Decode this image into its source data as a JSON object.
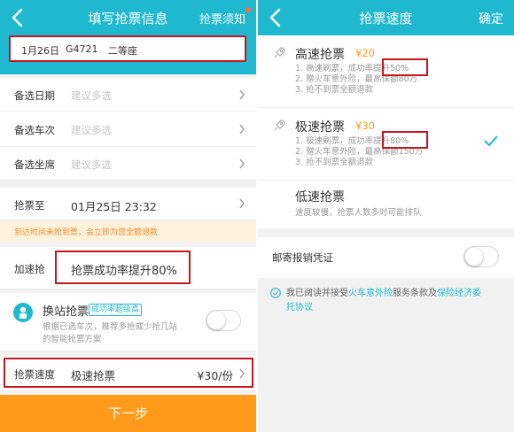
{
  "left": {
    "header": {
      "back_icon": "back-chevron-icon",
      "title": "填写抢票信息",
      "right_link": "抢票须知",
      "has_dot": true,
      "bg_color": "#20b8ce"
    },
    "ticket": {
      "date": "1月26日",
      "train": "G4721",
      "seat": "二等座"
    },
    "optional": [
      {
        "label": "备选日期",
        "placeholder": "建议多选"
      },
      {
        "label": "备选车次",
        "placeholder": "建议多选"
      },
      {
        "label": "备选坐席",
        "placeholder": "建议多选"
      }
    ],
    "deadline": {
      "label": "抢票至",
      "value": "01月25日 23:32"
    },
    "notice": "到达时间未抢到票，会立即为您全额退款",
    "accelerate": {
      "label": "加速抢",
      "value": "抢票成功率提升80%"
    },
    "transfer": {
      "icon": "ticket-transfer-icon",
      "title": "换站抢票",
      "badge": "成功率超级高",
      "desc_line1": "根据已选车次，推荐多抢或少抢几站",
      "desc_line2": "的智能抢票方案",
      "toggle_on": false
    },
    "speed": {
      "label": "抢票速度",
      "value": "极速抢票",
      "price": "¥30/份"
    },
    "next_button": "下一步",
    "colors": {
      "accent": "#20b8ce",
      "orange": "#ff9a1a",
      "highlight": "#c7161d"
    }
  },
  "right": {
    "header": {
      "back_icon": "back-chevron-icon",
      "title": "抢票速度",
      "confirm": "确定"
    },
    "options": [
      {
        "icon": "rocket-icon",
        "title": "高速抢票",
        "price": "¥20",
        "line1a": "1. 高速刷票，成功率",
        "line1b": "提升50%",
        "line2": "2. 赠火车意外险，最高保额80万",
        "line3": "3. 抢不到票全额退款",
        "selected": false
      },
      {
        "icon": "rocket-icon",
        "title": "极速抢票",
        "price": "¥30",
        "line1a": "1. 极速刷票，成功率",
        "line1b": "提升80%",
        "line2": "2. 赠火车意外险，最高保额150万",
        "line3": "3. 抢不到票全额退款",
        "selected": true
      },
      {
        "title": "低速抢票",
        "desc": "速度较慢，抢票人数多时可能排队"
      }
    ],
    "mail": {
      "label": "邮寄报销凭证",
      "toggle_on": false
    },
    "agreement": {
      "prefix": "我已阅读并接受",
      "link1": "火车意外险",
      "middle": "服务条款及",
      "link2": "保险经济委",
      "line2": "托协议"
    }
  }
}
